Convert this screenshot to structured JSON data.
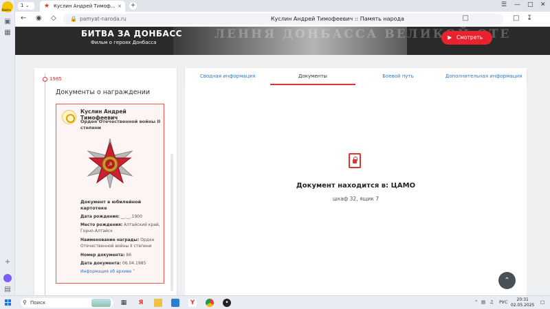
{
  "browser": {
    "tab_counter": "1",
    "tab_title": "Куслин Андрей Тимоф...",
    "url": "pamyat-naroda.ru",
    "page_title": "Куслин Андрей Тимофеевич :: Память народа",
    "avatar_label": "Войти"
  },
  "banner": {
    "title": "БИТВА ЗА ДОНБАСС",
    "subtitle": "Фильм о героях Донбасса",
    "wall_text": "ЛЕННЯ ДОНБАССА ВЕЛИКОЙ ОТЕ",
    "watch_label": "Смотреть"
  },
  "timeline": {
    "year": "1985",
    "section_title": "Документы о награждении"
  },
  "award": {
    "person": "Куслин Андрей Тимофеевич",
    "order": "Орден Отечественной войны II степени",
    "doc_type": "Документ в юбилейной картотеке",
    "fields": [
      {
        "label": "Дата рождения:",
        "value": "__.__.1900"
      },
      {
        "label": "Место рождения:",
        "value": "Алтайский край, Горно-Алтайск"
      },
      {
        "label": "Наименование награды:",
        "value": "Орден Отечественной войны II степени"
      },
      {
        "label": "Номер документа:",
        "value": "86"
      },
      {
        "label": "Дата документа:",
        "value": "06.04.1985"
      }
    ],
    "archive_link": "Информация об архиве"
  },
  "tabs": [
    {
      "label": "Сводная информация",
      "active": false
    },
    {
      "label": "Документы",
      "active": true
    },
    {
      "label": "Боевой путь",
      "active": false
    },
    {
      "label": "Дополнительная информация",
      "active": false
    }
  ],
  "document": {
    "location": "Документ находится в: ЦАМО",
    "details": "шкаф 32, ящик 7"
  },
  "taskbar": {
    "search_label": "Поиск",
    "lang": "РУС",
    "time": "20:31",
    "date": "02.05.2025"
  },
  "colors": {
    "accent": "#e8232e",
    "link": "#3478c8",
    "banner_bg": "#2a2a2a"
  }
}
